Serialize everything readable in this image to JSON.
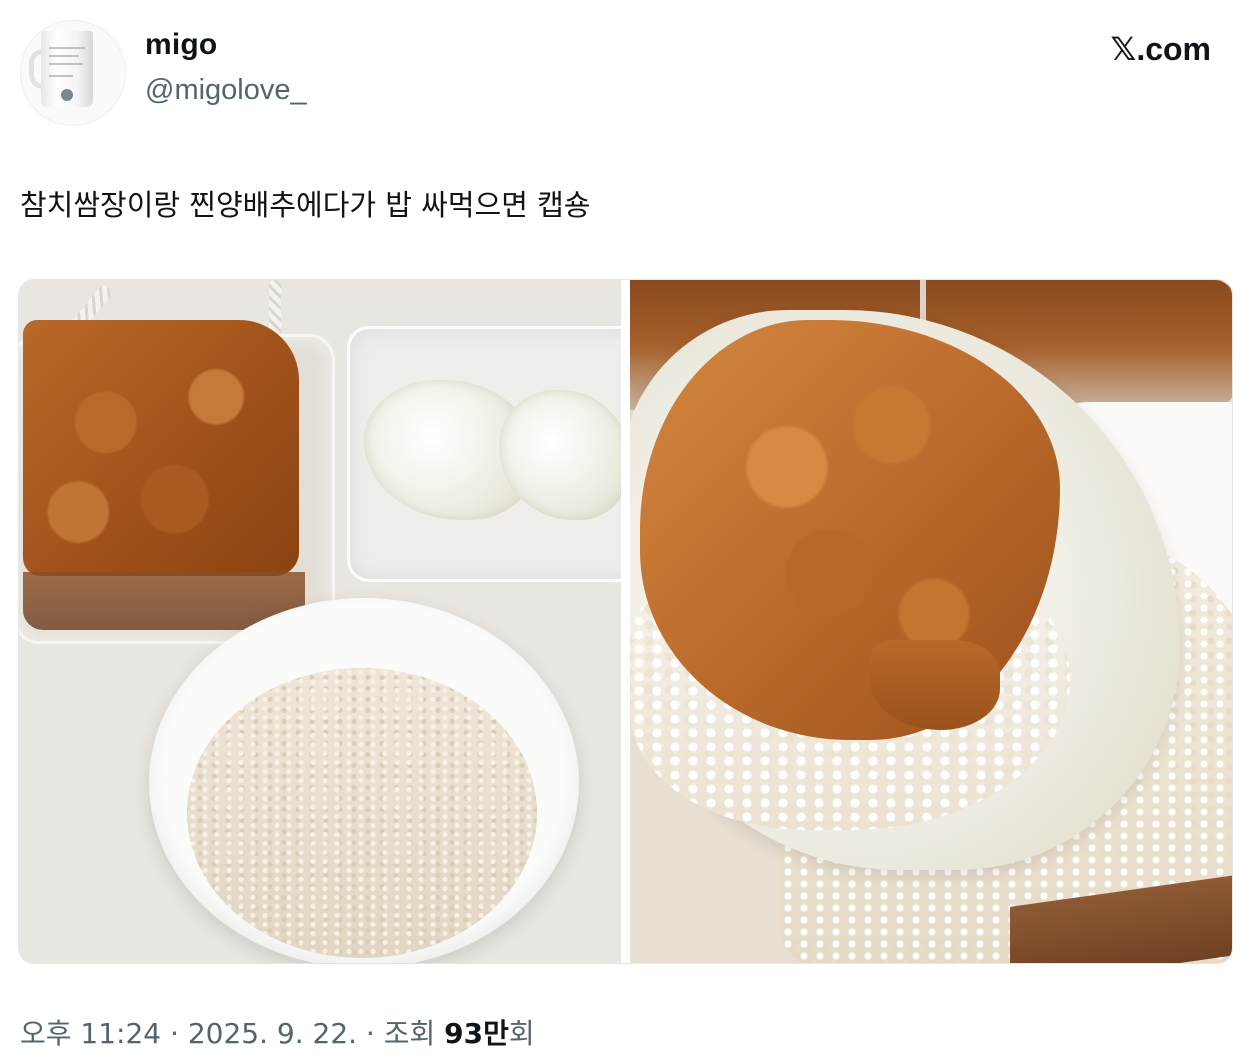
{
  "author": {
    "display_name": "migo",
    "handle": "@migolove_",
    "avatar_icon": "mug-avatar-icon"
  },
  "brand": {
    "logo_glyph": "𝕏",
    "logo_text": ".com"
  },
  "tweet": {
    "text": "참치쌈장이랑 찐양배추에다가 밥 싸먹으면 캡숑"
  },
  "media": {
    "count": 2
  },
  "meta": {
    "time": "오후 11:24",
    "date": "2025. 9. 22.",
    "separator": " · ",
    "views_label": "조회 ",
    "views_count": "93만",
    "views_suffix": "회"
  },
  "colors": {
    "text_primary": "#0f1419",
    "text_secondary": "#536471",
    "background": "#ffffff"
  }
}
